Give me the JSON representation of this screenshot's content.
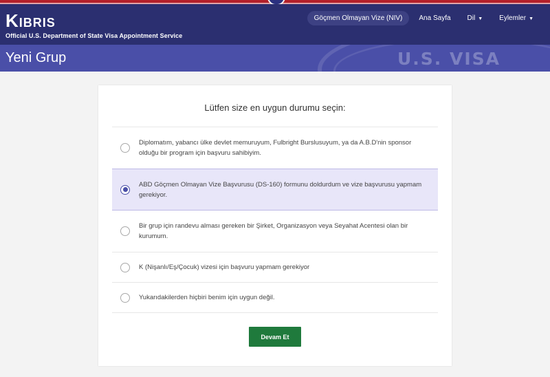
{
  "header": {
    "brand_title": "Kibris",
    "brand_subtitle": "Official U.S. Department of State Visa Appointment Service",
    "nav": {
      "niv": "Göçmen Olmayan Vize (NIV)",
      "home": "Ana Sayfa",
      "language": "Dil",
      "actions": "Eylemler"
    }
  },
  "subheader": {
    "title": "Yeni Grup",
    "watermark": "U.S. VISA"
  },
  "card": {
    "question": "Lütfen size en uygun durumu seçin:",
    "options": [
      {
        "label": "Diplomatım, yabancı ülke devlet memuruyum, Fulbright Burslusuyum, ya da A.B.D'nin sponsor olduğu bir program için başvuru sahibiyim.",
        "selected": false
      },
      {
        "label": "ABD Göçmen Olmayan Vize Başvurusu (DS-160) formunu doldurdum ve vize başvurusu yapmam gerekiyor.",
        "selected": true
      },
      {
        "label": "Bir grup için randevu alması gereken bir Şirket, Organizasyon veya Seyahat Acentesi olan bir kurumum.",
        "selected": false
      },
      {
        "label": "K (Nişanlı/Eş/Çocuk) vizesi için başvuru yapmam gerekiyor",
        "selected": false
      },
      {
        "label": "Yukarıdakilerden hiçbiri benim için uygun değil.",
        "selected": false
      }
    ],
    "continue_label": "Devam Et"
  },
  "colors": {
    "header_bg": "#2b2f70",
    "subheader_bg": "#4a4fa8",
    "selected_bg": "#e8e6f9",
    "button_bg": "#1f7a3c",
    "top_stripe": "#b3202a"
  }
}
